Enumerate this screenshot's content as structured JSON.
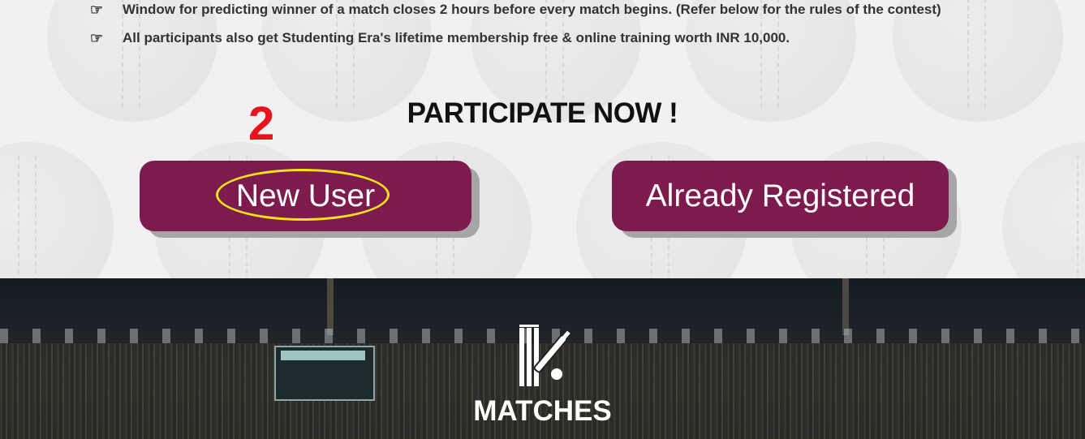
{
  "info": {
    "bullets": [
      "Window for predicting winner of a match closes 2 hours before every match begins. (Refer below for the rules of the contest)",
      "All participants also get Studenting Era's lifetime membership free & online training worth INR 10,000."
    ]
  },
  "participate": {
    "title": "PARTICIPATE NOW !",
    "step_number": "2",
    "new_user_label": "New User",
    "already_registered_label": "Already Registered"
  },
  "matches": {
    "title": "MATCHES"
  },
  "colors": {
    "button": "#7d1a4e",
    "step_number": "#e8141b",
    "highlight": "#f2e21a"
  }
}
